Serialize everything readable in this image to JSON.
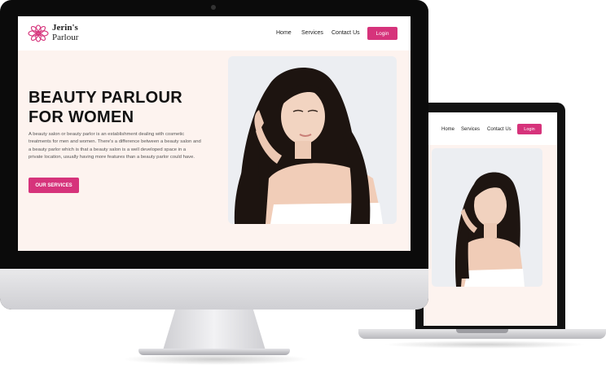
{
  "colors": {
    "accent": "#d6337b",
    "page_background": "#fdf3ef",
    "navbar_background": "#ffffff",
    "device_frame": "#0b0b0b"
  },
  "desktop": {
    "brand": {
      "line1": "Jerin's",
      "line2": "Parlour",
      "icon": "flower-lotus-icon"
    },
    "nav": {
      "home": "Home",
      "services": "Services",
      "contact": "Contact Us",
      "login": "Login"
    },
    "hero": {
      "title_line1": "BEAUTY PARLOUR",
      "title_line2": "FOR WOMEN",
      "description": "A beauty salon or beauty parlor is an establishment dealing with cosmetic treatments for men and women. There's a difference between a beauty salon and a beauty parlor which is that a beauty salon is a well developed space in a private location, usually having more features than a beauty parlor could have.",
      "cta": "OUR SERVICES"
    }
  },
  "laptop": {
    "nav": {
      "home": "Home",
      "services": "Services",
      "contact": "Contact Us",
      "login": "Login"
    }
  }
}
